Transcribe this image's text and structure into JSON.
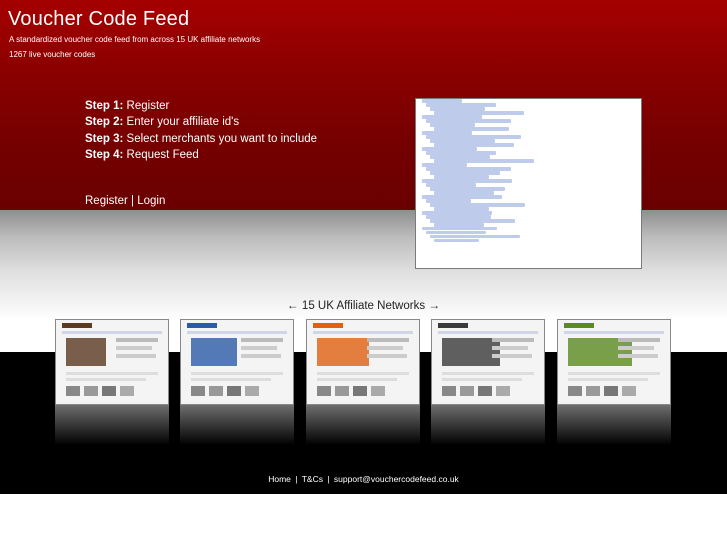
{
  "site": {
    "title": "Voucher Code Feed",
    "tagline": "A standardized voucher code feed from across 15 UK affiliate networks",
    "live_count": "1267 live voucher codes"
  },
  "steps": [
    {
      "label": "Step 1:",
      "text": " Register"
    },
    {
      "label": "Step 2:",
      "text": " Enter your affiliate id's"
    },
    {
      "label": "Step 3:",
      "text": " Select merchants you want to include"
    },
    {
      "label": "Step 4:",
      "text": " Request Feed"
    }
  ],
  "auth": {
    "register": "Register",
    "separator": "|",
    "login": "Login"
  },
  "networks": {
    "left_arrow": "←",
    "label": "15 UK Affiliate Networks",
    "right_arrow": "→"
  },
  "thumbnails": [
    {
      "name": "network-thumb-1",
      "accent": "#5a3a20"
    },
    {
      "name": "network-thumb-2",
      "accent": "#2a5aa8"
    },
    {
      "name": "network-thumb-3",
      "accent": "#e06010"
    },
    {
      "name": "network-thumb-4",
      "accent": "#3a3a3a"
    },
    {
      "name": "network-thumb-5",
      "accent": "#5a8a20"
    }
  ],
  "footer": {
    "home": "Home",
    "terms": "T&Cs",
    "email": "support@vouchercodefeed.co.uk",
    "separator": "|"
  },
  "colors": {
    "hero_red": "#8a0000",
    "footer_black": "#000000",
    "xml_tag": "#3a5fcd"
  }
}
